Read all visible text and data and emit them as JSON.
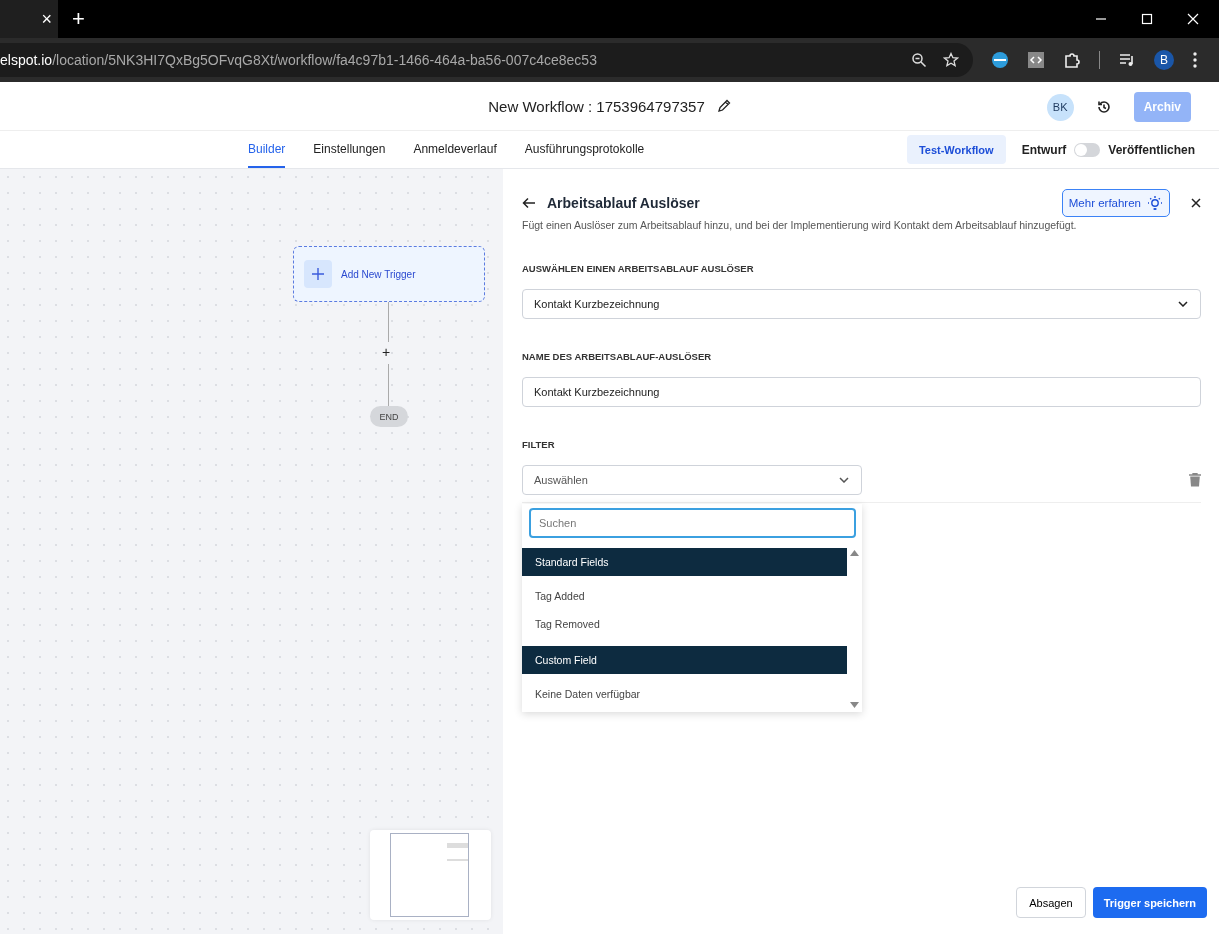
{
  "browser": {
    "tab_close": "×",
    "new_tab": "+",
    "url_host": "elspot.io",
    "url_path": "/location/5NK3HI7QxBg5OFvqG8Xt/workflow/fa4c97b1-1466-464a-ba56-007c4ce8ec53",
    "profile": "B"
  },
  "header": {
    "title": "New Workflow : 1753964797357",
    "avatar": "BK",
    "archive": {
      "label": "Archiv",
      "disabled": true
    }
  },
  "tabs": [
    {
      "label": "Builder",
      "selected": true
    },
    {
      "label": "Einstellungen",
      "selected": false
    },
    {
      "label": "Anmeldeverlauf",
      "selected": false
    },
    {
      "label": "Ausführungsprotokolle",
      "selected": false
    }
  ],
  "test_button": "Test-Workflow",
  "publish_toggle": {
    "off_label": "Entwurf",
    "on_label": "Veröffentlichen",
    "on": false
  },
  "canvas": {
    "trigger_node": "Add New Trigger",
    "add_step": "+",
    "end_node": "END"
  },
  "panel": {
    "title": "Arbeitsablauf Auslöser",
    "learn_more": "Mehr erfahren",
    "description": "Fügt einen Auslöser zum Arbeitsablauf hinzu, und bei der Implementierung wird Kontakt dem Arbeitsablauf hinzugefügt.",
    "trigger_label": "AUSWÄHLEN EINEN ARBEITSABLAUF AUSLÖSER",
    "trigger_value": "Kontakt Kurzbezeichnung",
    "name_label": "NAME DES ARBEITSABLAUF-AUSLÖSER",
    "name_value": "Kontakt Kurzbezeichnung",
    "filter_label": "FILTER",
    "filter_placeholder": "Auswählen",
    "dropdown": {
      "search_placeholder": "Suchen",
      "items": [
        {
          "kind": "group",
          "label": "Standard Fields"
        },
        {
          "kind": "option",
          "label": "Tag Added"
        },
        {
          "kind": "option",
          "label": "Tag Removed"
        },
        {
          "kind": "group",
          "label": "Custom Field"
        },
        {
          "kind": "empty",
          "label": "Keine Daten verfügbar"
        }
      ]
    }
  },
  "footer": {
    "cancel": "Absagen",
    "save": "Trigger speichern"
  }
}
